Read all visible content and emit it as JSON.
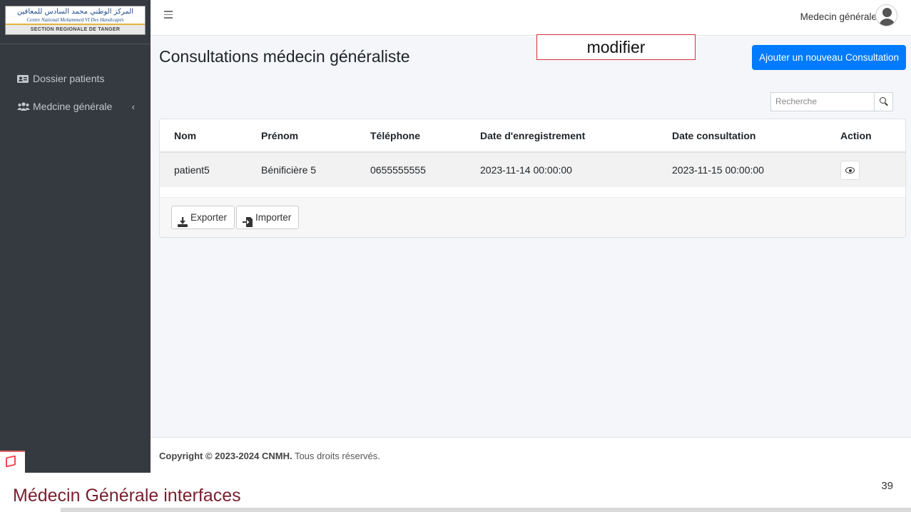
{
  "logo": {
    "arabic": "المركز الوطني محمد السادس للمعاقين",
    "french": "Centre National Mohammed VI Des Handicapés",
    "section": "SECTION REGIONALE DE TANGER"
  },
  "sidebar": {
    "items": [
      {
        "label": "Dossier patients",
        "icon": "id-card-icon"
      },
      {
        "label": "Medcine générale",
        "icon": "users-icon",
        "chevron": "‹"
      }
    ]
  },
  "topbar": {
    "user_name": "Medecin générale"
  },
  "page": {
    "title": "Consultations médecin généraliste",
    "annotation": "modifier",
    "add_button": "Ajouter un nouveau Consultation",
    "search_placeholder": "Recherche"
  },
  "table": {
    "headers": [
      "Nom",
      "Prénom",
      "Téléphone",
      "Date d'enregistrement",
      "Date consultation",
      "Action"
    ],
    "rows": [
      {
        "nom": "patient5",
        "prenom": "Bénificière 5",
        "telephone": "0655555555",
        "date_enregistrement": "2023-11-14 00:00:00",
        "date_consultation": "2023-11-15 00:00:00"
      }
    ]
  },
  "actions": {
    "export": "Exporter",
    "import": "Importer"
  },
  "footer": {
    "copyright_bold": "Copyright © 2023-2024 CNMH.",
    "rights": " Tous droits réservés."
  },
  "slide": {
    "caption": "Médecin Générale interfaces",
    "number": "39"
  },
  "colors": {
    "sidebar": "#343a40",
    "primary": "#007bff",
    "caption": "#7a1f2e"
  }
}
